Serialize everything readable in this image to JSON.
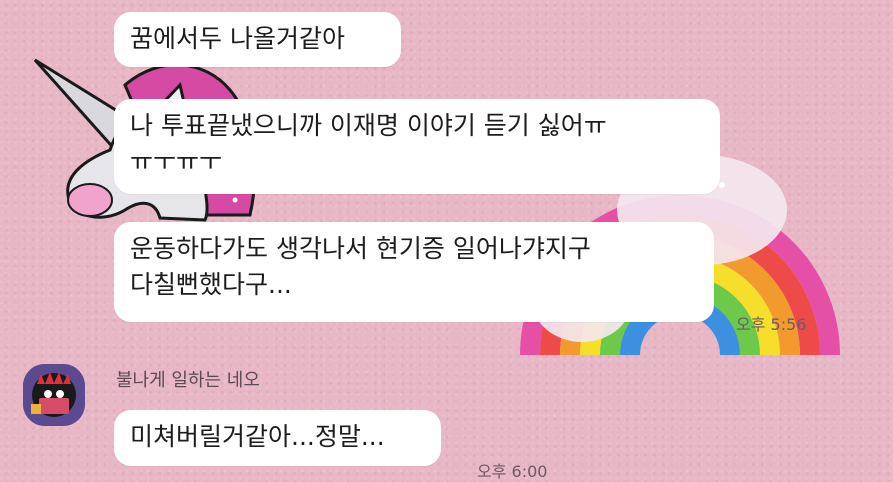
{
  "chat": {
    "messages": [
      {
        "text": "꿈에서두 나올거같아"
      },
      {
        "line1": "나 투표끝냈으니까 이재명 이야기 듣기 싫어ㅠ",
        "line2": "ㅠㅜㅠㅜ"
      },
      {
        "line1": "운동하다가도 생각나서 현기증 일어나갸지구",
        "line2": "다칠뻔했다구..."
      }
    ],
    "first_group_time": "오후 5:56",
    "second_sender": {
      "name": "불나게 일하는 네오",
      "message": "미쳐버릴거같아...정말...",
      "time": "오후 6:00"
    }
  },
  "colors": {
    "background": "#e7b7c6",
    "bubble": "#ffffff",
    "time_text": "#6d5a63"
  },
  "decorations": [
    "unicorn-sticker",
    "rainbow-sticker"
  ]
}
